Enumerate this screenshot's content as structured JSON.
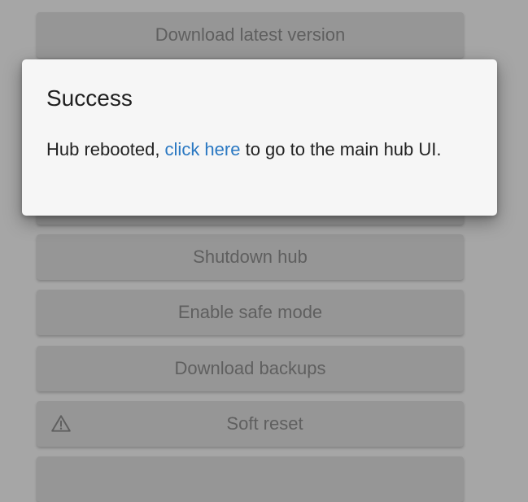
{
  "buttons": {
    "download_latest": "Download latest version",
    "shutdown": "Shutdown hub",
    "safe_mode": "Enable safe mode",
    "backups": "Download backups",
    "soft_reset": "Soft reset"
  },
  "icons": {
    "soft_reset_icon": "warning-icon"
  },
  "modal": {
    "title": "Success",
    "body_before": "Hub rebooted, ",
    "link_text": "click here",
    "body_after": " to go to the main hub UI."
  },
  "colors": {
    "link": "#2a78c2",
    "overlay_bg": "#a6a6a6",
    "button_bg": "#969696",
    "modal_bg": "#f6f6f6"
  }
}
